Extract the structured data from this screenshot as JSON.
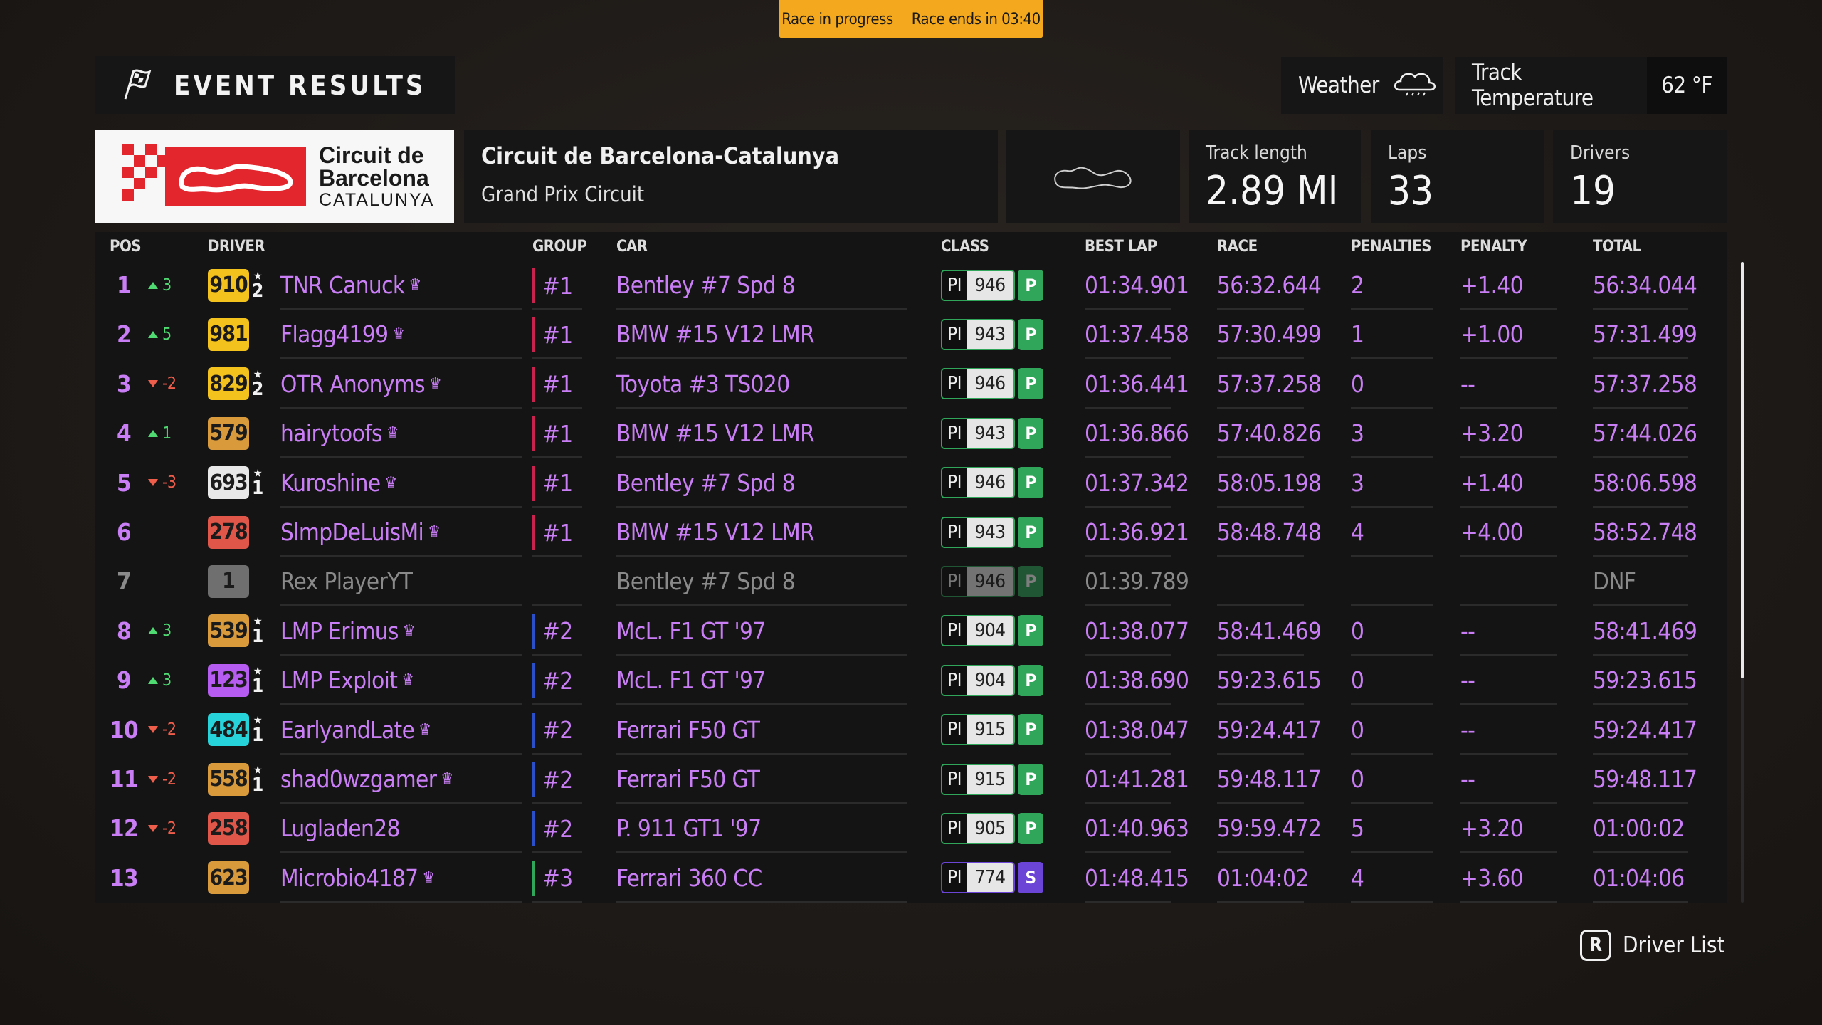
{
  "banner": {
    "status": "Race in progress",
    "countdown": "Race ends in 03:40"
  },
  "header": {
    "title": "EVENT RESULTS",
    "weather_label": "Weather",
    "weather_icon": "cloud-rain-icon",
    "temp_label": "Track Temperature",
    "temp_value": "62 °F"
  },
  "track": {
    "logo_line1": "Circuit de",
    "logo_line2": "Barcelona",
    "logo_line3": "CATALUNYA",
    "name": "Circuit de Barcelona-Catalunya",
    "layout": "Grand Prix Circuit",
    "stats": [
      {
        "label": "Track length",
        "value": "2.89 MI"
      },
      {
        "label": "Laps",
        "value": "33"
      },
      {
        "label": "Drivers",
        "value": "19"
      }
    ]
  },
  "columns": {
    "pos": "POS",
    "driver": "DRIVER",
    "group": "GROUP",
    "car": "CAR",
    "class": "CLASS",
    "best_lap": "BEST LAP",
    "race": "RACE",
    "penalties": "PENALTIES",
    "penalty": "PENALTY",
    "total": "TOTAL"
  },
  "colors": {
    "accent": "#c97ef5",
    "banner": "#f3a81e",
    "up": "#4fdb72",
    "down": "#ef5d4b",
    "class_P": "#2fa65a",
    "class_S": "#6b45d6",
    "group_1": "#c8224e",
    "group_2": "#2a4fc9",
    "group_3": "#2fa65a"
  },
  "rows": [
    {
      "pos": "1",
      "dir": "up",
      "chg": "3",
      "rating": "910",
      "badge": "#f4c21c",
      "star": "2",
      "driver": "TNR Canuck",
      "crown": true,
      "group": "#1",
      "gcol": "#c8224e",
      "car": "Bentley #7 Spd 8",
      "pl": "PI",
      "pi": "946",
      "cls": "P",
      "clsc": "#2fa65a",
      "best": "01:34.901",
      "race": "56:32.644",
      "pens": "2",
      "pen": "+1.40",
      "total": "56:34.044"
    },
    {
      "pos": "2",
      "dir": "up",
      "chg": "5",
      "rating": "981",
      "badge": "#f4c21c",
      "star": "",
      "driver": "Flagg4199",
      "crown": true,
      "group": "#1",
      "gcol": "#c8224e",
      "car": "BMW #15 V12 LMR",
      "pl": "PI",
      "pi": "943",
      "cls": "P",
      "clsc": "#2fa65a",
      "best": "01:37.458",
      "race": "57:30.499",
      "pens": "1",
      "pen": "+1.00",
      "total": "57:31.499"
    },
    {
      "pos": "3",
      "dir": "down",
      "chg": "-2",
      "rating": "829",
      "badge": "#f4c21c",
      "star": "2",
      "driver": "OTR Anonyms",
      "crown": true,
      "group": "#1",
      "gcol": "#c8224e",
      "car": "Toyota #3 TS020",
      "pl": "PI",
      "pi": "946",
      "cls": "P",
      "clsc": "#2fa65a",
      "best": "01:36.441",
      "race": "57:37.258",
      "pens": "0",
      "pen": "--",
      "total": "57:37.258"
    },
    {
      "pos": "4",
      "dir": "up",
      "chg": "1",
      "rating": "579",
      "badge": "#d99a3c",
      "star": "",
      "driver": "hairytoofs",
      "crown": true,
      "group": "#1",
      "gcol": "#c8224e",
      "car": "BMW #15 V12 LMR",
      "pl": "PI",
      "pi": "943",
      "cls": "P",
      "clsc": "#2fa65a",
      "best": "01:36.866",
      "race": "57:40.826",
      "pens": "3",
      "pen": "+3.20",
      "total": "57:44.026"
    },
    {
      "pos": "5",
      "dir": "down",
      "chg": "-3",
      "rating": "693",
      "badge": "#e8e8e8",
      "star": "1",
      "driver": "Kuroshine",
      "crown": true,
      "group": "#1",
      "gcol": "#c8224e",
      "car": "Bentley #7 Spd 8",
      "pl": "PI",
      "pi": "946",
      "cls": "P",
      "clsc": "#2fa65a",
      "best": "01:37.342",
      "race": "58:05.198",
      "pens": "3",
      "pen": "+1.40",
      "total": "58:06.598"
    },
    {
      "pos": "6",
      "dir": "",
      "chg": "",
      "rating": "278",
      "badge": "#e0574a",
      "star": "",
      "driver": "SlmpDeLuisMi",
      "crown": true,
      "group": "#1",
      "gcol": "#c8224e",
      "car": "BMW #15 V12 LMR",
      "pl": "PI",
      "pi": "943",
      "cls": "P",
      "clsc": "#2fa65a",
      "best": "01:36.921",
      "race": "58:48.748",
      "pens": "4",
      "pen": "+4.00",
      "total": "58:52.748"
    },
    {
      "pos": "7",
      "dir": "",
      "chg": "",
      "rating": "1",
      "badge": "#6f6f6f",
      "star": "",
      "driver": "Rex PlayerYT",
      "crown": false,
      "group": "",
      "gcol": "transparent",
      "car": "Bentley #7 Spd 8",
      "pl": "PI",
      "pi": "946",
      "cls": "P",
      "clsc": "#2fa65a",
      "best": "01:39.789",
      "race": "",
      "pens": "",
      "pen": "",
      "total": "DNF",
      "dnf": true
    },
    {
      "pos": "8",
      "dir": "up",
      "chg": "3",
      "rating": "539",
      "badge": "#d99a3c",
      "star": "1",
      "driver": "LMP Erimus",
      "crown": true,
      "group": "#2",
      "gcol": "#2a4fc9",
      "car": "McL. F1 GT '97",
      "pl": "PI",
      "pi": "904",
      "cls": "P",
      "clsc": "#2fa65a",
      "best": "01:38.077",
      "race": "58:41.469",
      "pens": "0",
      "pen": "--",
      "total": "58:41.469"
    },
    {
      "pos": "9",
      "dir": "up",
      "chg": "3",
      "rating": "123",
      "badge": "#b65cf0",
      "star": "1",
      "driver": "LMP Exploit",
      "crown": true,
      "group": "#2",
      "gcol": "#2a4fc9",
      "car": "McL. F1 GT '97",
      "pl": "PI",
      "pi": "904",
      "cls": "P",
      "clsc": "#2fa65a",
      "best": "01:38.690",
      "race": "59:23.615",
      "pens": "0",
      "pen": "--",
      "total": "59:23.615"
    },
    {
      "pos": "10",
      "dir": "down",
      "chg": "-2",
      "rating": "484",
      "badge": "#27d3db",
      "star": "1",
      "driver": "EarlyandLate",
      "crown": true,
      "group": "#2",
      "gcol": "#2a4fc9",
      "car": "Ferrari F50 GT",
      "pl": "PI",
      "pi": "915",
      "cls": "P",
      "clsc": "#2fa65a",
      "best": "01:38.047",
      "race": "59:24.417",
      "pens": "0",
      "pen": "--",
      "total": "59:24.417"
    },
    {
      "pos": "11",
      "dir": "down",
      "chg": "-2",
      "rating": "558",
      "badge": "#d99a3c",
      "star": "1",
      "driver": "shad0wzgamer",
      "crown": true,
      "group": "#2",
      "gcol": "#2a4fc9",
      "car": "Ferrari F50 GT",
      "pl": "PI",
      "pi": "915",
      "cls": "P",
      "clsc": "#2fa65a",
      "best": "01:41.281",
      "race": "59:48.117",
      "pens": "0",
      "pen": "--",
      "total": "59:48.117"
    },
    {
      "pos": "12",
      "dir": "down",
      "chg": "-2",
      "rating": "258",
      "badge": "#e0574a",
      "star": "",
      "driver": "Lugladen28",
      "crown": false,
      "group": "#2",
      "gcol": "#2a4fc9",
      "car": "P. 911 GT1 '97",
      "pl": "PI",
      "pi": "905",
      "cls": "P",
      "clsc": "#2fa65a",
      "best": "01:40.963",
      "race": "59:59.472",
      "pens": "5",
      "pen": "+3.20",
      "total": "01:00:02"
    },
    {
      "pos": "13",
      "dir": "",
      "chg": "",
      "rating": "623",
      "badge": "#d99a3c",
      "star": "",
      "driver": "Microbio4187",
      "crown": true,
      "group": "#3",
      "gcol": "#2fa65a",
      "car": "Ferrari 360 CC",
      "pl": "PI",
      "pi": "774",
      "cls": "S",
      "clsc": "#6b45d6",
      "best": "01:48.415",
      "race": "01:04:02",
      "pens": "4",
      "pen": "+3.60",
      "total": "01:04:06"
    }
  ],
  "scroll": {
    "visible_fraction": 0.65
  },
  "footer": {
    "key": "R",
    "label": "Driver List"
  }
}
